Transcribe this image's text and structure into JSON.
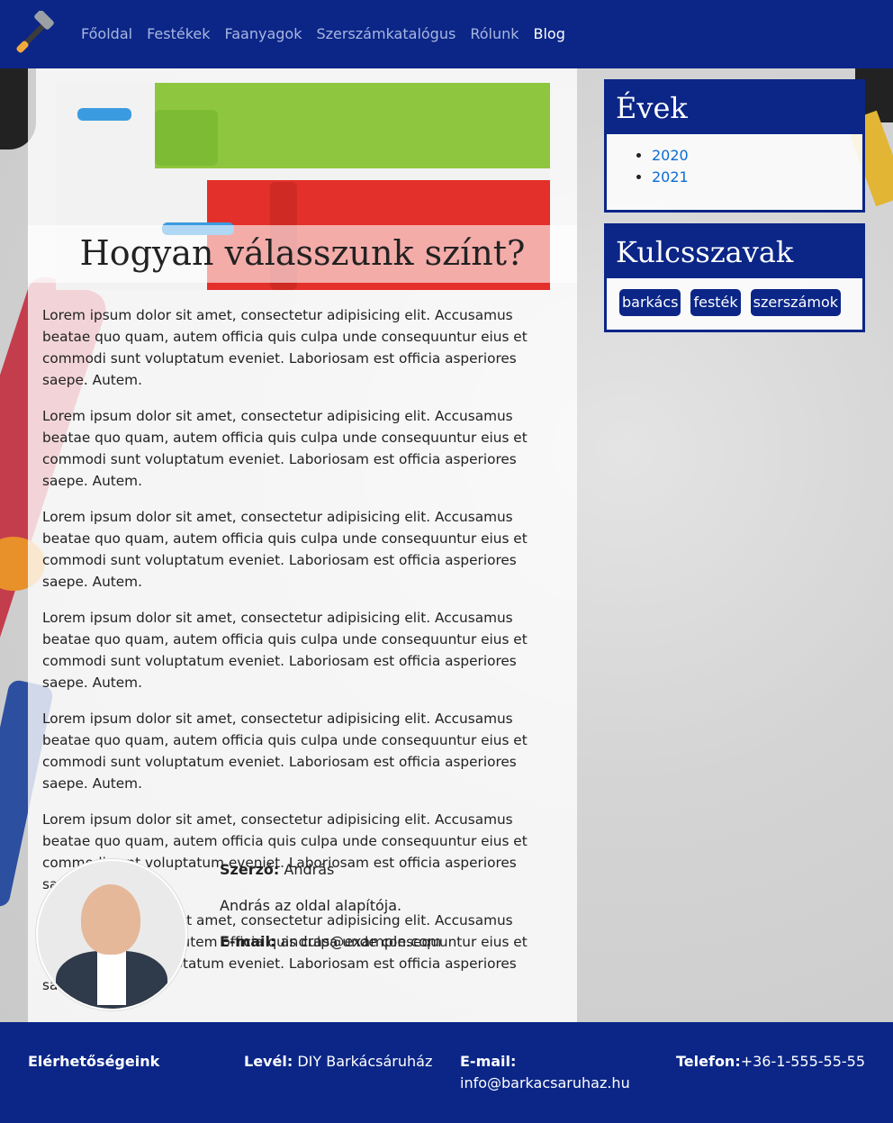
{
  "nav": {
    "items": [
      {
        "label": "Főoldal",
        "active": false
      },
      {
        "label": "Festékek",
        "active": false
      },
      {
        "label": "Faanyagok",
        "active": false
      },
      {
        "label": "Szerszámkatalógus",
        "active": false
      },
      {
        "label": "Rólunk",
        "active": false
      },
      {
        "label": "Blog",
        "active": true
      }
    ],
    "logo_icon": "hammer-icon"
  },
  "post": {
    "title": "Hogyan válasszunk színt?",
    "paragraphs": [
      "Lorem ipsum dolor sit amet, consectetur adipisicing elit. Accusamus beatae quo quam, autem officia quis culpa unde consequuntur eius et commodi sunt voluptatum eveniet. Laboriosam est officia asperiores saepe. Autem.",
      "Lorem ipsum dolor sit amet, consectetur adipisicing elit. Accusamus beatae quo quam, autem officia quis culpa unde consequuntur eius et commodi sunt voluptatum eveniet. Laboriosam est officia asperiores saepe. Autem.",
      "Lorem ipsum dolor sit amet, consectetur adipisicing elit. Accusamus beatae quo quam, autem officia quis culpa unde consequuntur eius et commodi sunt voluptatum eveniet. Laboriosam est officia asperiores saepe. Autem.",
      "Lorem ipsum dolor sit amet, consectetur adipisicing elit. Accusamus beatae quo quam, autem officia quis culpa unde consequuntur eius et commodi sunt voluptatum eveniet. Laboriosam est officia asperiores saepe. Autem.",
      "Lorem ipsum dolor sit amet, consectetur adipisicing elit. Accusamus beatae quo quam, autem officia quis culpa unde consequuntur eius et commodi sunt voluptatum eveniet. Laboriosam est officia asperiores saepe. Autem.",
      "Lorem ipsum dolor sit amet, consectetur adipisicing elit. Accusamus beatae quo quam, autem officia quis culpa unde consequuntur eius et commodi sunt voluptatum eveniet. Laboriosam est officia asperiores saepe. Autem.",
      "Lorem ipsum dolor sit amet, consectetur adipisicing elit. Accusamus beatae quo quam, autem officia quis culpa unde consequuntur eius et commodi sunt voluptatum eveniet. Laboriosam est officia asperiores saepe. Autem."
    ]
  },
  "author": {
    "name_label": "Szerző:",
    "name": "András",
    "bio": "András az oldal alapítója.",
    "email_label": "E-mail:",
    "email": "andras@example.com"
  },
  "sidebar": {
    "years_title": "Évek",
    "years": [
      "2020",
      "2021"
    ],
    "keywords_title": "Kulcsszavak",
    "keywords": [
      "barkács",
      "festék",
      "szerszámok"
    ]
  },
  "footer": {
    "contacts_title": "Elérhetőségeink",
    "mail_label": "Levél:",
    "mail_value": "DIY Barkácsáruház",
    "email_label": "E-mail:",
    "email_value": "info@barkacsaruhaz.hu",
    "phone_label": "Telefon:",
    "phone_value": "+36-1-555-55-55"
  },
  "colors": {
    "primary": "#0b2687",
    "link": "#0b6bd6"
  }
}
